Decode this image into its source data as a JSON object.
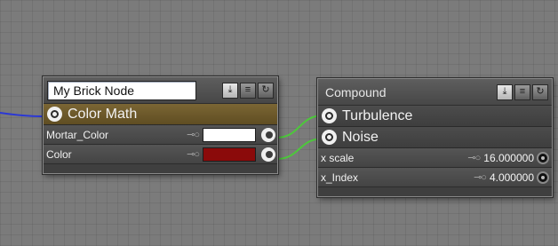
{
  "canvas": {
    "background": "#7b7b7b",
    "wire_color_green": "#4cc93a",
    "wire_color_blue": "#2a37d6"
  },
  "node_left": {
    "name_value": "My Brick Node",
    "header_icons": [
      "import-icon",
      "list-icon",
      "refresh-icon"
    ],
    "title": "Color  Math",
    "title_icon": "target-icon",
    "title_color": "#6c5a2c",
    "rows": [
      {
        "label": "Mortar_Color",
        "swatch": "#ffffff",
        "output_icon": "output-port-icon"
      },
      {
        "label": "Color",
        "swatch": "#8b0a0a",
        "output_icon": "output-port-icon"
      }
    ]
  },
  "node_right": {
    "title": "Compound",
    "header_icons": [
      "import-icon",
      "list-icon",
      "refresh-icon"
    ],
    "inputs": [
      {
        "label": "Turbulence",
        "icon": "target-icon"
      },
      {
        "label": "Noise",
        "icon": "target-icon"
      }
    ],
    "params": [
      {
        "label": "x scale",
        "value": "16.000000"
      },
      {
        "label": "x_Index",
        "value": "4.000000"
      }
    ]
  }
}
